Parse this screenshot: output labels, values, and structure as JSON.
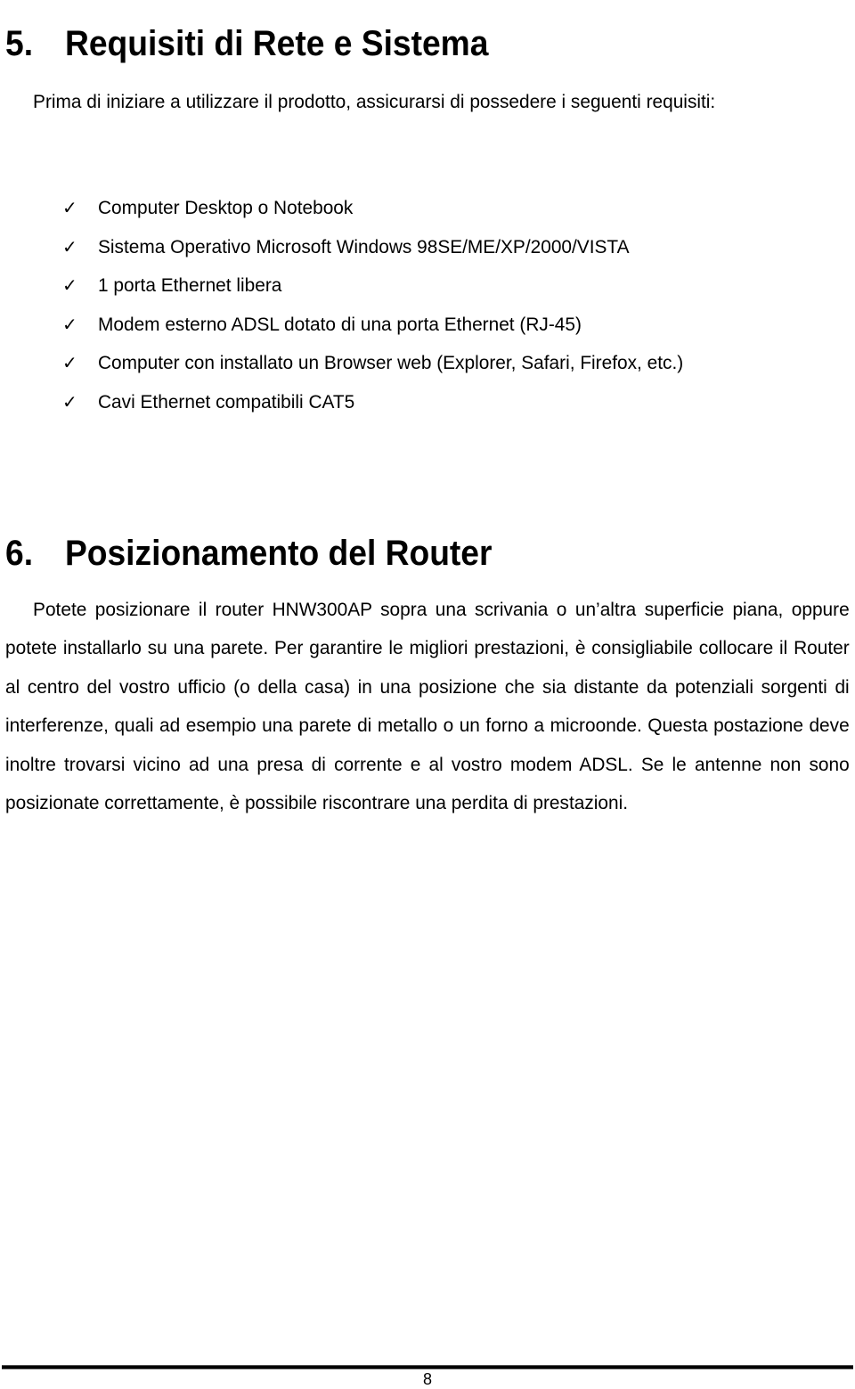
{
  "section5": {
    "number": "5.",
    "title": "Requisiti di Rete e Sistema",
    "intro": "Prima di iniziare a utilizzare il prodotto, assicurarsi di possedere i seguenti requisiti:",
    "requirements": [
      {
        "icon": "checkmark-icon",
        "text": "Computer Desktop o Notebook"
      },
      {
        "icon": "checkmark-icon",
        "text": "Sistema Operativo Microsoft Windows 98SE/ME/XP/2000/VISTA"
      },
      {
        "icon": "checkmark-icon",
        "text": "1 porta Ethernet libera"
      },
      {
        "icon": "checkmark-icon",
        "text": "Modem esterno ADSL dotato di una porta Ethernet (RJ-45)"
      },
      {
        "icon": "checkmark-icon",
        "text": "Computer con installato un Browser web (Explorer, Safari, Firefox, etc.)"
      },
      {
        "icon": "checkmark-icon",
        "text": "Cavi Ethernet compatibili CAT5"
      }
    ],
    "check_glyph": "✓"
  },
  "section6": {
    "number": "6.",
    "title": "Posizionamento del Router",
    "body": "Potete posizionare il router HNW300AP sopra una scrivania o un’altra superficie piana, oppure potete installarlo su una parete. Per garantire le migliori prestazioni, è consigliabile collocare il Router al centro del vostro ufficio (o della casa) in una posizione che sia distante da potenziali sorgenti di interferenze, quali ad esempio una parete di metallo o un forno a microonde. Questa postazione deve inoltre trovarsi vicino ad una presa di corrente e al vostro modem ADSL. Se le antenne non sono posizionate correttamente, è possibile riscontrare una perdita di prestazioni."
  },
  "footer": {
    "page_number": "8"
  }
}
